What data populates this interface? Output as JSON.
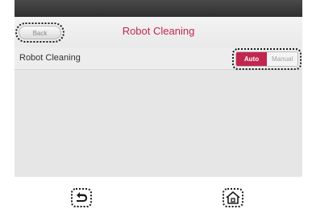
{
  "header": {
    "back_label": "Back",
    "title": "Robot Cleaning"
  },
  "setting": {
    "label": "Robot Cleaning",
    "options": [
      "Auto",
      "Manual"
    ],
    "selected": "Auto"
  },
  "colors": {
    "accent": "#c2264f",
    "top_bar": "#3a3a3a",
    "background": "#e6e6e6"
  },
  "nav": {
    "back_icon": "return-arrow-icon",
    "home_icon": "home-icon"
  }
}
